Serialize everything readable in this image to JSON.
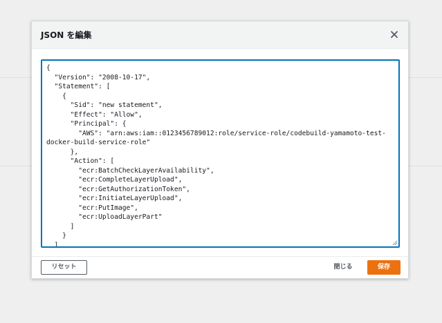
{
  "dialog": {
    "title": "JSON を編集",
    "close_icon": "close-icon"
  },
  "editor": {
    "lines": [
      "{",
      "  \"Version\": \"2008-10-17\",",
      "  \"Statement\": [",
      "    {",
      "      \"Sid\": \"new statement\",",
      "      \"Effect\": \"Allow\",",
      "      \"Principal\": {",
      "        \"AWS\": \"arn:aws:iam::0123456789012:role/service-role/codebuild-yamamoto-test-",
      "docker-build-service-role\"",
      "      },",
      "      \"Action\": [",
      "        \"ecr:BatchCheckLayerAvailability\",",
      "        \"ecr:CompleteLayerUpload\",",
      "        \"ecr:GetAuthorizationToken\",",
      "        \"ecr:InitiateLayerUpload\",",
      "        \"ecr:PutImage\",",
      "        \"ecr:UploadLayerPart\"",
      "      ]",
      "    }",
      "  ]",
      "}"
    ]
  },
  "footer": {
    "reset_label": "リセット",
    "close_label": "閉じる",
    "save_label": "保存"
  },
  "colors": {
    "accent_border": "#0073bb",
    "save_button": "#ec7211"
  }
}
